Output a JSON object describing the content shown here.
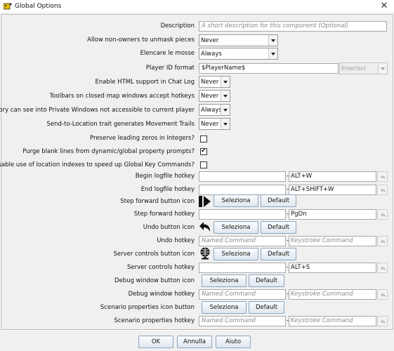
{
  "window": {
    "title": "Global Options",
    "close_glyph": "✕",
    "app_icon": "vassal-app-icon"
  },
  "description": {
    "label": "Description",
    "placeholder": "A short description for this component (Optional)"
  },
  "unmask": {
    "label": "Allow non-owners to unmask pieces",
    "value": "Never"
  },
  "moves": {
    "label": "Elencare le mosse",
    "value": "Always"
  },
  "player_id": {
    "label": "Player ID format",
    "value": "$PlayerName$",
    "insert_value": "Inserisci"
  },
  "html_chat": {
    "label": "Enable HTML support in Chat Log",
    "value": "Never"
  },
  "toolbars": {
    "label": "Toolbars on closed map windows accept hotkeys",
    "value": "Never"
  },
  "inventory": {
    "label": "Inventory can see into Private Windows not accessible to current player",
    "value": "Always"
  },
  "send_location": {
    "label": "Send-to-Location trait generates Movement Trails",
    "value": "Never"
  },
  "preserve_zeros": {
    "label": "Preserve leading zeros in Integers?",
    "checked": false
  },
  "purge_blank": {
    "label": "Purge blank lines from dynamic/global property prompts?",
    "checked": true
  },
  "disable_loc": {
    "label": "Disable use of location indexes to speed up Global Key Commands?",
    "checked": false
  },
  "begin_log": {
    "label": "Begin logfile hotkey",
    "named": "",
    "keystroke": "ALT+W"
  },
  "end_log": {
    "label": "End logfile hotkey",
    "named": "",
    "keystroke": "ALT+SHIFT+W"
  },
  "step_icon": {
    "label": "Step forward button icon",
    "icon": "step-forward-icon"
  },
  "step_hotkey": {
    "label": "Step forward hotkey",
    "named": "",
    "keystroke": "PgDn"
  },
  "undo_icon": {
    "label": "Undo button icon",
    "icon": "undo-arrow-icon"
  },
  "undo_hotkey": {
    "label": "Undo hotkey",
    "named_placeholder": "Named Command",
    "keystroke_placeholder": "Keystroke Command"
  },
  "server_icon": {
    "label": "Server controls button icon",
    "icon": "server-globe-icon"
  },
  "server_hotkey": {
    "label": "Server controls hotkey",
    "named": "",
    "keystroke": "ALT+S"
  },
  "debug_icon": {
    "label": "Debug window button icon"
  },
  "debug_hotkey": {
    "label": "Debug window hotkey",
    "named_placeholder": "Named Command",
    "keystroke_placeholder": "Keystroke Command"
  },
  "scenario_icon": {
    "label": "Scenario properties icon button"
  },
  "scenario_hotkey": {
    "label": "Scenario properties hotkey",
    "named_placeholder": "Named Command",
    "keystroke_placeholder": "Keystroke Command"
  },
  "buttons": {
    "select": "Seleziona",
    "default": "Default",
    "ok": "OK",
    "cancel": "Annulla",
    "help": "Aiuto",
    "dash": "-"
  },
  "colors": {
    "button_border": "#8aa6c1",
    "panel": "#f0f0f0",
    "placeholder": "#8a8a8a"
  }
}
